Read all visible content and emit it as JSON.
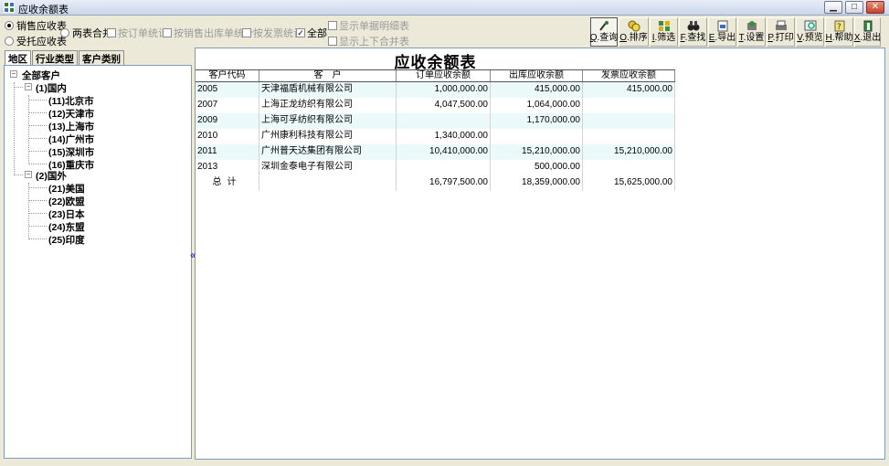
{
  "window": {
    "title": "应收余额表"
  },
  "options": {
    "radio_sales": "销售应收表",
    "radio_consign": "受托应收表",
    "radio_merge": "两表合并",
    "check_order": "按订单统计",
    "check_outbound": "按销售出库单统计",
    "check_invoice": "按发票统计",
    "check_all": "全部",
    "check_detail": "显示单据明细表",
    "check_merge_vertical": "显示上下合并表"
  },
  "toolbar": [
    {
      "key": "Q",
      "label": "查询",
      "icon": "query-icon"
    },
    {
      "key": "O",
      "label": "排序",
      "icon": "sort-icon"
    },
    {
      "key": "I",
      "label": "筛选",
      "icon": "filter-icon"
    },
    {
      "key": "F",
      "label": "查找",
      "icon": "find-binoculars-icon"
    },
    {
      "key": "E",
      "label": "导出",
      "icon": "export-icon"
    },
    {
      "key": "T",
      "label": "设置",
      "icon": "settings-icon"
    },
    {
      "key": "P",
      "label": "打印",
      "icon": "print-icon"
    },
    {
      "key": "V",
      "label": "预览",
      "icon": "preview-icon"
    },
    {
      "key": "H",
      "label": "帮助",
      "icon": "help-icon"
    },
    {
      "key": "X",
      "label": "退出",
      "icon": "exit-icon"
    }
  ],
  "tabs": [
    "地区",
    "行业类型",
    "客户类别"
  ],
  "tree": {
    "root": "全部客户",
    "domestic": "(1)国内",
    "domestic_children": [
      "(11)北京市",
      "(12)天津市",
      "(13)上海市",
      "(14)广州市",
      "(15)深圳市",
      "(16)重庆市"
    ],
    "foreign": "(2)国外",
    "foreign_children": [
      "(21)美国",
      "(22)欧盟",
      "(23)日本",
      "(24)东盟",
      "(25)印度"
    ]
  },
  "collapse_glyph": "«",
  "report": {
    "title": "应收余额表",
    "columns": [
      "客户代码",
      "客　户",
      "订单应收余额",
      "出库应收余额",
      "发票应收余额"
    ],
    "rows": [
      [
        "2005",
        "天津福盾机械有限公司",
        "1,000,000.00",
        "415,000.00",
        "415,000.00"
      ],
      [
        "2007",
        "上海正龙纺织有限公司",
        "4,047,500.00",
        "1,064,000.00",
        ""
      ],
      [
        "2009",
        "上海可孚纺织有限公司",
        "",
        "1,170,000.00",
        ""
      ],
      [
        "2010",
        "广州康利科技有限公司",
        "1,340,000.00",
        "",
        ""
      ],
      [
        "2011",
        "广州普天达集团有限公司",
        "10,410,000.00",
        "15,210,000.00",
        "15,210,000.00"
      ],
      [
        "2013",
        "深圳金泰电子有限公司",
        "",
        "500,000.00",
        ""
      ]
    ],
    "total": [
      "总计",
      "",
      "16,797,500.00",
      "18,359,000.00",
      "15,625,000.00"
    ]
  }
}
